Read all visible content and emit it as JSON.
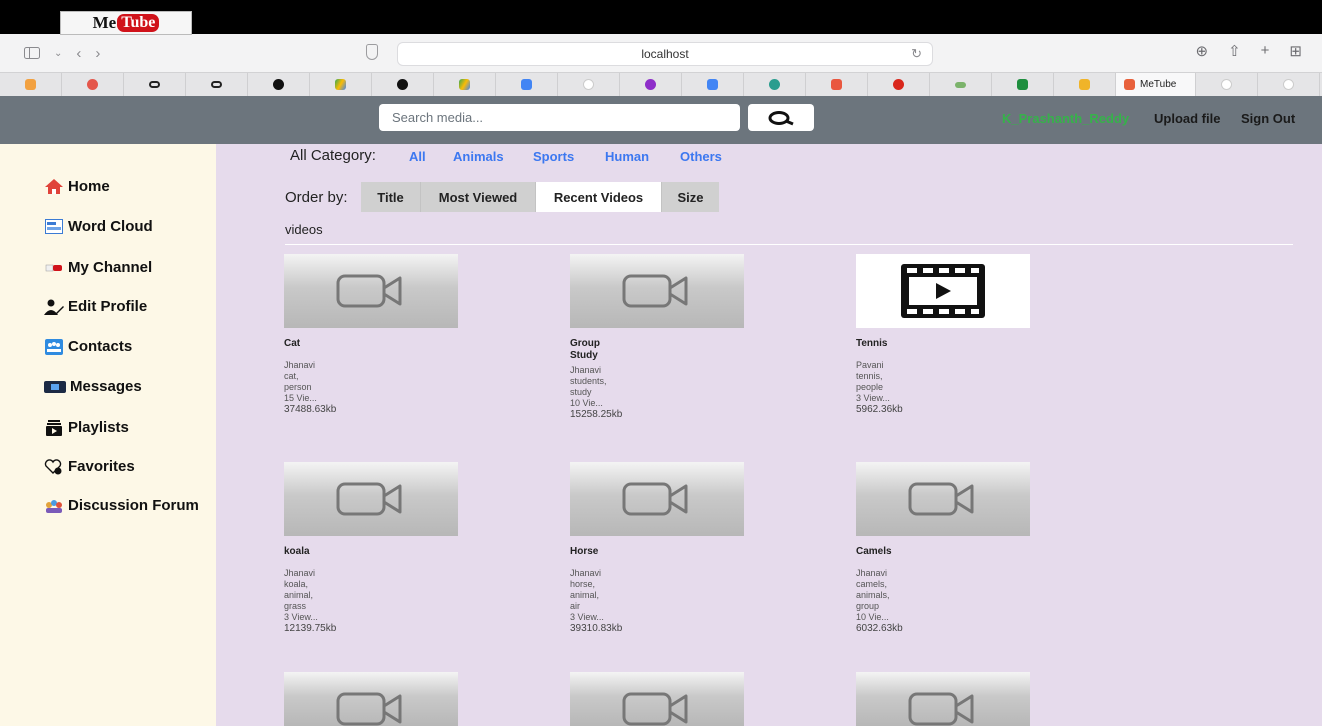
{
  "browser": {
    "url": "localhost",
    "active_tab_label": "MeTube"
  },
  "app": {
    "brand_left": "Me",
    "brand_right": "Tube",
    "search_placeholder": "Search media...",
    "username": "K_Prashanth_Reddy",
    "upload_label": "Upload file",
    "signout_label": "Sign Out"
  },
  "sidebar": {
    "items": [
      {
        "label": "Home",
        "icon": "home-icon"
      },
      {
        "label": "Word Cloud",
        "icon": "word-cloud-icon"
      },
      {
        "label": "My Channel",
        "icon": "youtube-icon"
      },
      {
        "label": "Edit Profile",
        "icon": "edit-profile-icon"
      },
      {
        "label": "Contacts",
        "icon": "contacts-icon"
      },
      {
        "label": "Messages",
        "icon": "messages-icon"
      },
      {
        "label": "Playlists",
        "icon": "playlists-icon"
      },
      {
        "label": "Favorites",
        "icon": "favorites-icon"
      },
      {
        "label": "Discussion Forum",
        "icon": "discussion-forum-icon"
      }
    ]
  },
  "filters": {
    "category_label": "All Category:",
    "categories": [
      "All",
      "Animals",
      "Sports",
      "Human",
      "Others"
    ],
    "order_label": "Order by:",
    "order_options": [
      "Title",
      "Most Viewed",
      "Recent Videos",
      "Size"
    ],
    "selected_order": "Recent Videos",
    "section_label": "videos"
  },
  "videos": [
    {
      "title": "Cat",
      "title2": "",
      "author": "Jhanavi",
      "tags": [
        "cat,",
        "person"
      ],
      "views": "15 Vie...",
      "size": "37488.63kb"
    },
    {
      "title": "Group",
      "title2": "Study",
      "author": "Jhanavi",
      "tags": [
        "students,",
        "study"
      ],
      "views": "10 Vie...",
      "size": "15258.25kb"
    },
    {
      "title": "Tennis",
      "title2": "",
      "author": "Pavani",
      "tags": [
        "tennis,",
        "people"
      ],
      "views": "3 View...",
      "size": "5962.36kb"
    },
    {
      "title": "koala",
      "title2": "",
      "author": "Jhanavi",
      "tags": [
        "koala,",
        "animal,",
        "grass"
      ],
      "views": "3 View...",
      "size": "12139.75kb"
    },
    {
      "title": "Horse",
      "title2": "",
      "author": "Jhanavi",
      "tags": [
        "horse,",
        "animal,",
        "air"
      ],
      "views": "3 View...",
      "size": "39310.83kb"
    },
    {
      "title": "Camels",
      "title2": "",
      "author": "Jhanavi",
      "tags": [
        "camels,",
        "animals,",
        "group"
      ],
      "views": "10 Vie...",
      "size": "6032.63kb"
    }
  ],
  "colors": {
    "navbar": "#6c757d",
    "sidebar": "#fdf8e7",
    "main": "#e6dbec",
    "link": "#3c78f0",
    "username": "#36b24a"
  }
}
